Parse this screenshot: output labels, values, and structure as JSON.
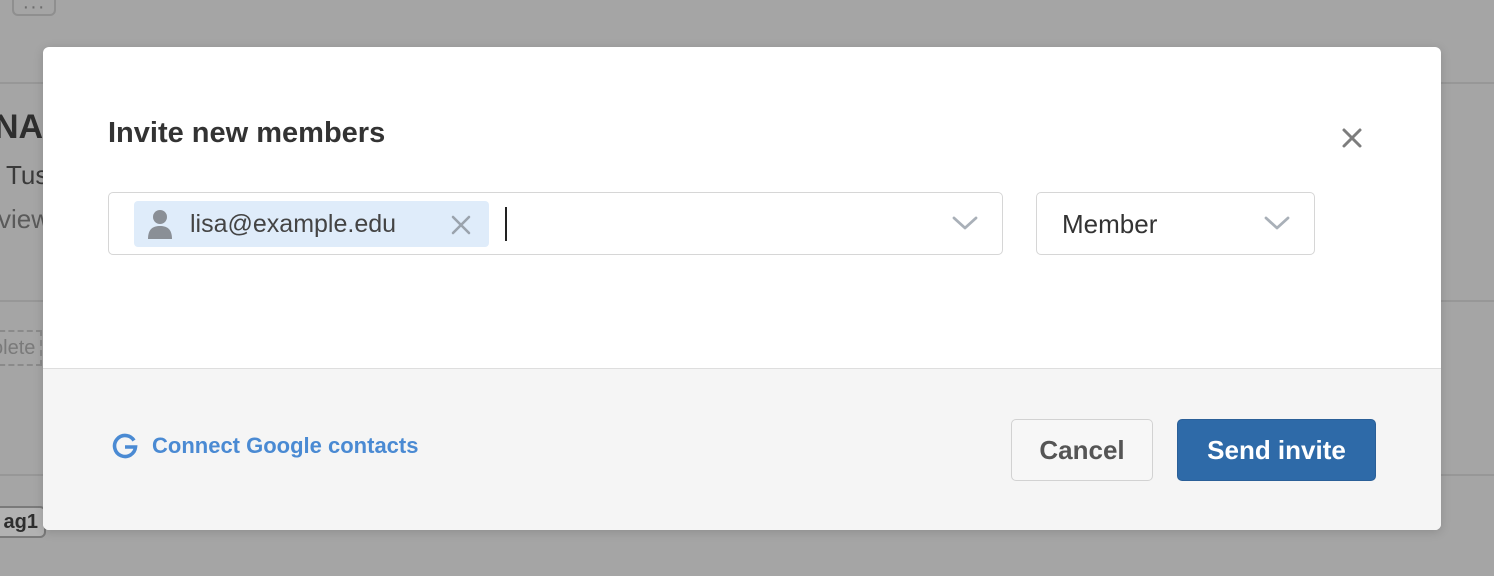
{
  "background": {
    "more_label": "···",
    "title_fragment": "NA",
    "subtitle_fragment": "Tus",
    "view_fragment": "view",
    "completed_fragment": "olete",
    "tag_fragment": "ag1"
  },
  "modal": {
    "title": "Invite new members",
    "invite_field": {
      "chips": [
        {
          "label": "lisa@example.edu"
        }
      ]
    },
    "role_select": {
      "selected": "Member"
    },
    "footer": {
      "google_link_label": "Connect Google contacts",
      "cancel_label": "Cancel",
      "send_label": "Send invite"
    }
  },
  "colors": {
    "primary_button": "#2e6aa8",
    "link": "#4a8ad3",
    "chip_background": "#dfecfa",
    "overlay": "#a5a5a5"
  }
}
